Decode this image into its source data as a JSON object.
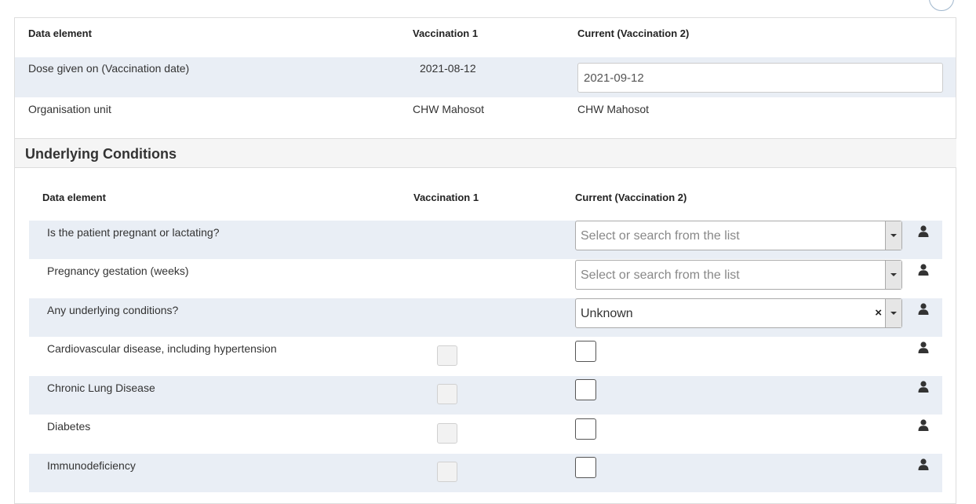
{
  "top_table": {
    "headers": [
      "Data element",
      "Vaccination 1",
      "Current (Vaccination 2)"
    ],
    "dose_label": "Dose given on (Vaccination date)",
    "dose_v1": "2021-08-12",
    "dose_current": "2021-09-12",
    "org_label": "Organisation unit",
    "org_v1": "CHW Mahosot",
    "org_current": "CHW Mahosot"
  },
  "section": {
    "title": "Underlying Conditions",
    "headers": [
      "Data element",
      "Vaccination 1",
      "Current (Vaccination 2)"
    ],
    "rows": [
      {
        "label": "Is the patient pregnant or lactating?",
        "placeholder": "Select or search from the list"
      },
      {
        "label": "Pregnancy gestation (weeks)",
        "placeholder": "Select or search from the list"
      },
      {
        "label": "Any underlying conditions?",
        "value": "Unknown",
        "clear": "×"
      },
      {
        "label": "Cardiovascular disease, including hypertension"
      },
      {
        "label": "Chronic Lung Disease"
      },
      {
        "label": "Diabetes"
      },
      {
        "label": "Immunodeficiency"
      }
    ]
  },
  "icons": {
    "row_action": "user-icon",
    "clear": "close-icon",
    "dropdown": "caret-down-icon"
  }
}
